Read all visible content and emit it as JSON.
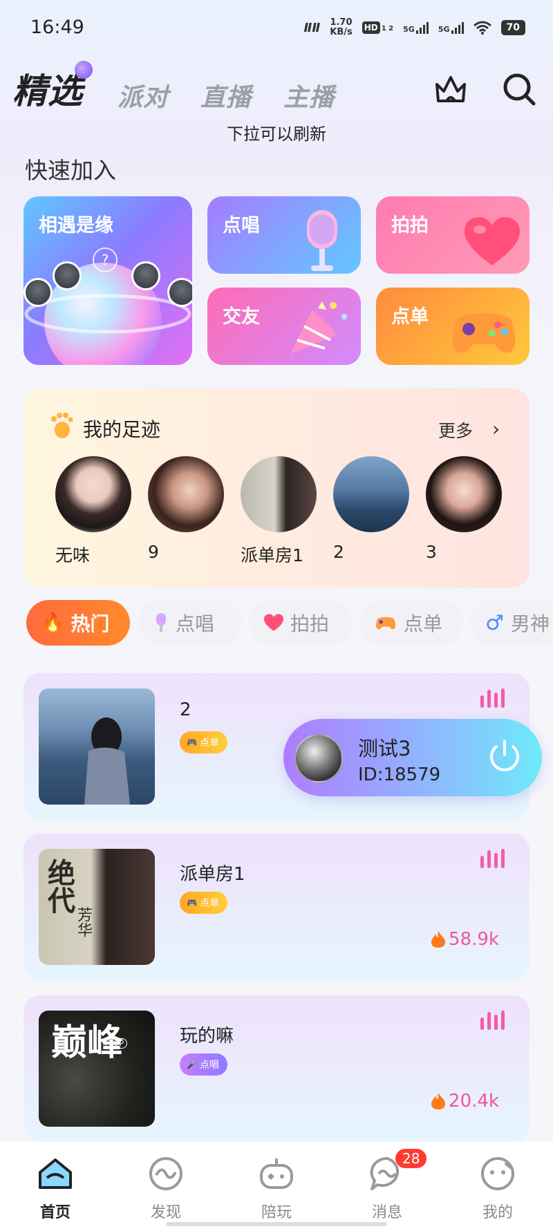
{
  "status_bar": {
    "time": "16:49",
    "speed_value": "1.70",
    "speed_unit": "KB/s",
    "hd_label": "HD",
    "hd_sub": "1 2",
    "net1": "5G",
    "net2": "5G",
    "battery": "70"
  },
  "top_tabs": [
    {
      "label": "精选",
      "active": true
    },
    {
      "label": "派对",
      "active": false
    },
    {
      "label": "直播",
      "active": false
    },
    {
      "label": "主播",
      "active": false
    }
  ],
  "pull_hint": "下拉可以刷新",
  "quick_join": {
    "title": "快速加入",
    "cards": [
      {
        "label": "相遇是缘"
      },
      {
        "label": "点唱"
      },
      {
        "label": "拍拍"
      },
      {
        "label": "交友"
      },
      {
        "label": "点单"
      }
    ]
  },
  "footprint": {
    "title": "我的足迹",
    "more": "更多",
    "items": [
      {
        "name": "无味"
      },
      {
        "name": "9"
      },
      {
        "name": "派单房1"
      },
      {
        "name": "2"
      },
      {
        "name": "3"
      }
    ]
  },
  "categories": [
    {
      "label": "热门",
      "icon": "flame-icon",
      "active": true
    },
    {
      "label": "点唱",
      "icon": "microphone-icon",
      "active": false
    },
    {
      "label": "拍拍",
      "icon": "heart-icon",
      "active": false
    },
    {
      "label": "点单",
      "icon": "gamepad-icon",
      "active": false
    },
    {
      "label": "男神",
      "icon": "male-icon",
      "active": false
    }
  ],
  "rooms": [
    {
      "title": "2",
      "tag": "点单",
      "heat": ""
    },
    {
      "title": "派单房1",
      "tag": "点单",
      "heat": "58.9k"
    },
    {
      "title": "玩的嘛",
      "tag": "点唱",
      "heat": "20.4k"
    }
  ],
  "room_cover_text": {
    "poster_big": "绝代",
    "poster_small": "芳华",
    "peak_big": "巅峰",
    "peak_top": "TOP"
  },
  "floating_user": {
    "name": "测试3",
    "id": "ID:18579"
  },
  "bottom_nav": [
    {
      "label": "首页",
      "active": true
    },
    {
      "label": "发现",
      "active": false
    },
    {
      "label": "陪玩",
      "active": false
    },
    {
      "label": "消息",
      "active": false,
      "badge": "28"
    },
    {
      "label": "我的",
      "active": false
    }
  ],
  "colors": {
    "accent_orange": "#ff6a3d",
    "heat_pink": "#f2559a",
    "badge_red": "#ff3b30"
  }
}
